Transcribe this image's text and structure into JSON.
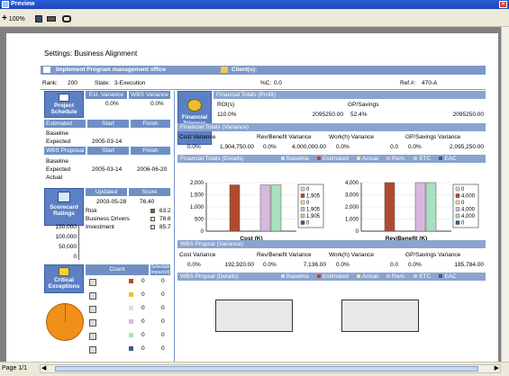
{
  "window": {
    "title": "Preview",
    "close": "×"
  },
  "toolbar": {
    "zoom": "100%"
  },
  "status": {
    "page": "Page 1/1"
  },
  "report": {
    "settings_title": "Settings: Business Alignment",
    "office": "Implement Program management office",
    "clients_label": "Client(s):",
    "rank_label": "Rank:",
    "rank": "200",
    "state_label": "State:",
    "state": "3-Execution",
    "pc_label": "%C:",
    "pc": "0.0",
    "ref_label": "Ref.#:",
    "ref": "470-A",
    "project_schedule": {
      "title": "Project Schedule",
      "est_var_h": "Est. Variance",
      "wbs_var_h": "WBS Variance",
      "est_var": "0.0%",
      "wbs_var": "0.0%",
      "estimated_h": "Estimated",
      "start_h": "Start",
      "finish_h": "Finish",
      "baseline": "Baseline",
      "expected": "Expected",
      "exp_start": "2005-03-14",
      "wbs_proposal_h": "WBS Proposal",
      "start2_h": "Start",
      "finish2_h": "Finish",
      "baseline2": "Baseline",
      "expected2": "Expected",
      "exp2_start": "2005-03-14",
      "exp2_finish": "2006-06-20",
      "actual": "Actual"
    },
    "financial": {
      "title": "Financial Triggers",
      "totals_profit": "Financial Totals (Profit)",
      "roi_h": "ROI(s)",
      "gp_h": "GP/Savings",
      "roi_pct": "110.0%",
      "roi_val": "2095250.00",
      "gp_pct": "52.4%",
      "gp_val": "2095250.00",
      "totals_variance": "Financial Totals (Variance)",
      "cost_var_h": "Cost Variance",
      "rev_var_h": "Rev/Benefit Variance",
      "work_var_h": "Work(h) Variance",
      "gp_var_h": "GP/Savings Variance",
      "cost_pct": "0.0%",
      "cost_val": "1,904,750.00",
      "rev_pct": "0.0%",
      "rev_val": "4,000,000.00",
      "work_pct": "0.0%",
      "work_val": "0.0",
      "gp_pct2": "0.0%",
      "gp_val2": "2,095,250.00",
      "totals_details": "Financial Totals (Details)",
      "wbs_var_title": "WBS Propsal (Variance)",
      "w_cost_h": "Cost Variance",
      "w_rev_h": "Rev/Benefit Variance",
      "w_work_h": "Work(h) Variance",
      "w_gp_h": "GP/Savings Variance",
      "w_cost_pct": "0.0%",
      "w_cost_val": "192,920.00",
      "w_rev_pct": "0.0%",
      "w_rev_val": "7,136.00",
      "w_work_pct": "0.0%",
      "w_work_val": "0.0",
      "w_gp_pct": "0.0%",
      "w_gp_val": "185,784.00",
      "wbs_details": "WBS Propsal (Details)"
    },
    "legend": [
      "Baseline",
      "Estimated",
      "Actual",
      "Rem.",
      "ETC",
      "EAC"
    ],
    "scorecard": {
      "title": "Scorecard Ratings",
      "updated_h": "Updated",
      "score_h": "Score",
      "updated": "2003-05-28",
      "score": "76.40",
      "rows": [
        {
          "name": "Risk",
          "val": "63.2"
        },
        {
          "name": "Business Drivers",
          "val": "78.6"
        },
        {
          "name": "Investment",
          "val": "85.7"
        }
      ],
      "axis": [
        "150,000",
        "100,000",
        "50,000",
        "0"
      ]
    },
    "critical": {
      "title": "Critical Exceptions",
      "count_h": "Count",
      "sched_h": "Schedule Impact(d)",
      "rows": [
        {
          "c": "0",
          "s": "0"
        },
        {
          "c": "0",
          "s": "0"
        },
        {
          "c": "0",
          "s": "0"
        },
        {
          "c": "0",
          "s": "0"
        },
        {
          "c": "0",
          "s": "0"
        },
        {
          "c": "0",
          "s": "0"
        }
      ]
    },
    "cost_chart": {
      "label": "Cost (K)",
      "axis": [
        "2,000",
        "1,500",
        "1,000",
        "500",
        "0"
      ],
      "legend": [
        "0",
        "1,905",
        "0",
        "1,905",
        "1,905",
        "0"
      ]
    },
    "rev_chart": {
      "label": "Rev/Benefit (K)",
      "axis": [
        "4,000",
        "3,000",
        "2,000",
        "1,000",
        "0"
      ],
      "legend": [
        "0",
        "4,000",
        "0",
        "4,000",
        "4,000",
        "0"
      ]
    }
  },
  "chart_data": [
    {
      "type": "bar",
      "categories": [
        "Baseline",
        "Estimated",
        "Actual",
        "Rem.",
        "ETC",
        "EAC"
      ],
      "values": [
        0,
        1905,
        0,
        1905,
        1905,
        0
      ],
      "xlabel": "Cost (K)",
      "ylim": [
        0,
        2000
      ]
    },
    {
      "type": "bar",
      "categories": [
        "Baseline",
        "Estimated",
        "Actual",
        "Rem.",
        "ETC",
        "EAC"
      ],
      "values": [
        0,
        4000,
        0,
        4000,
        4000,
        0
      ],
      "xlabel": "Rev/Benefit (K)",
      "ylim": [
        0,
        4000
      ]
    }
  ],
  "colors": {
    "baseline": "#c9e0f5",
    "estimated": "#b04a2e",
    "actual": "#f0e0a0",
    "rem": "#d9b8e0",
    "etc": "#a8e0c0",
    "eac": "#3a5a8a"
  }
}
